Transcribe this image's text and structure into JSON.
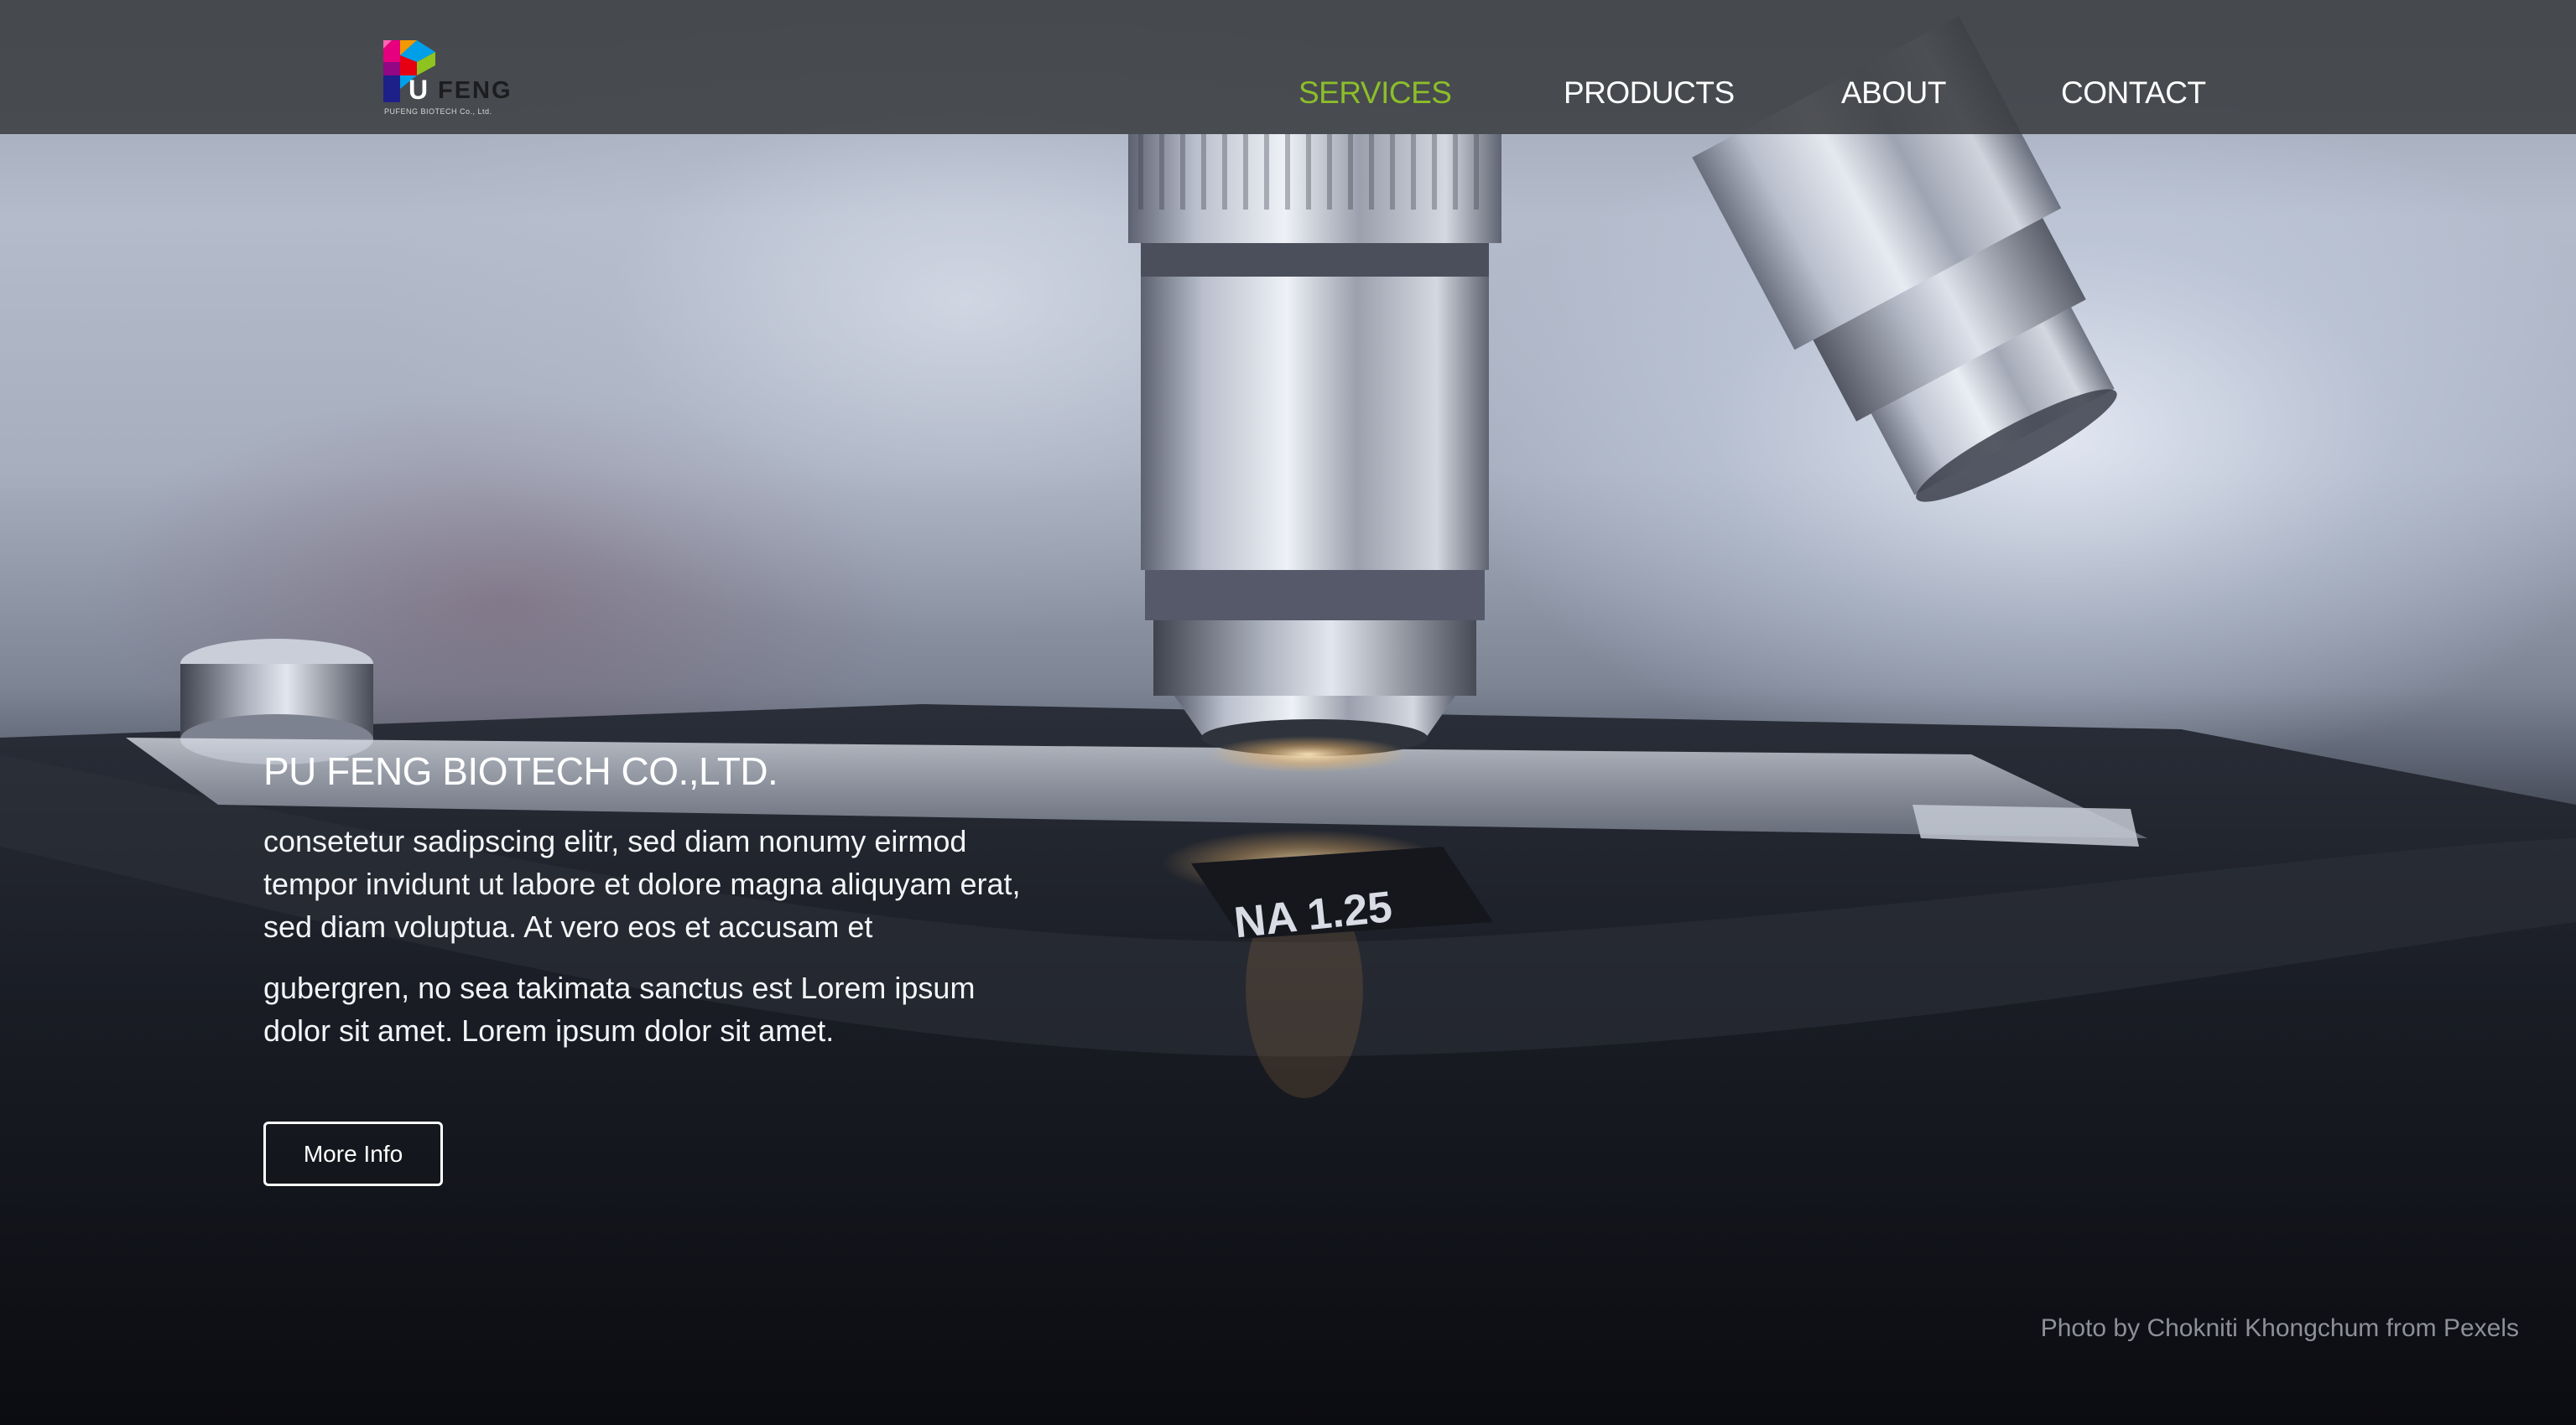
{
  "brand": {
    "logo_letter": "U",
    "logo_text": "FENG",
    "logo_subtitle": "PUFENG BIOTECH Co., Ltd."
  },
  "nav": {
    "items": [
      {
        "label": "SERVICES",
        "active": true
      },
      {
        "label": "PRODUCTS",
        "active": false
      },
      {
        "label": "ABOUT",
        "active": false
      },
      {
        "label": "CONTACT",
        "active": false
      }
    ]
  },
  "hero": {
    "title": "PU FENG BIOTECH CO.,LTD.",
    "paragraph_1": "consetetur sadipscing elitr, sed diam nonumy eirmod tempor invidunt ut labore et dolore magna aliquyam erat, sed diam voluptua. At vero eos et accusam et",
    "paragraph_2": "gubergren, no sea takimata sanctus est Lorem ipsum dolor sit amet. Lorem ipsum dolor sit amet.",
    "button_label": "More Info",
    "lens_marking": "NA 1.25"
  },
  "photo_credit": "Photo by Chokniti Khongchum from Pexels",
  "colors": {
    "header_bg": "#3a3c40",
    "nav_active": "#8cbe2a",
    "nav_default": "#ffffff",
    "credit_text": "#8e9099"
  },
  "icons": {
    "logo": "pufeng-logo-icon"
  }
}
